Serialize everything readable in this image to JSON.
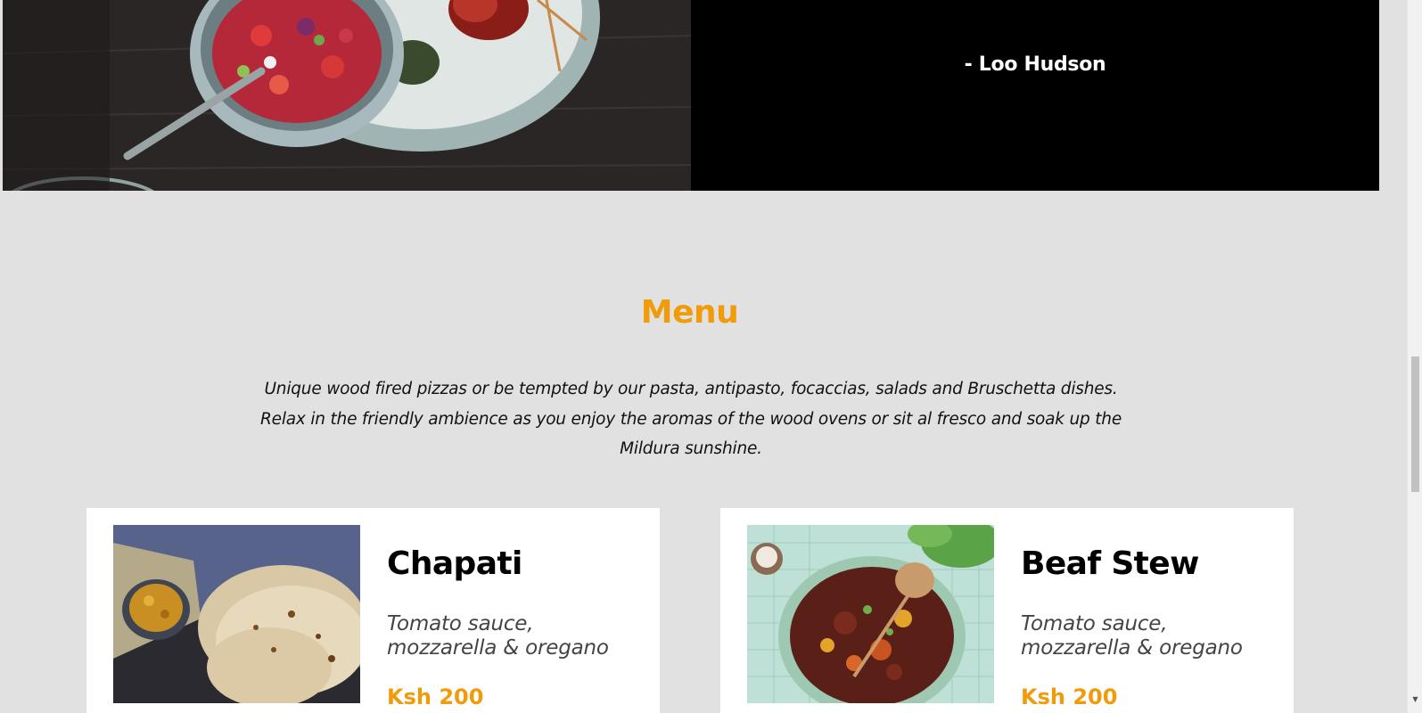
{
  "testimonial": {
    "author": "- Loo Hudson"
  },
  "menu": {
    "title": "Menu",
    "intro": "Unique wood fired pizzas or be tempted by our pasta, antipasto, focaccias, salads and Bruschetta dishes. Relax in the friendly ambience as you enjoy the aromas of the wood ovens or sit al fresco and soak up the Mildura sunshine.",
    "items": [
      {
        "name": "Chapati",
        "description": "Tomato sauce, mozzarella & oregano",
        "price": "Ksh 200"
      },
      {
        "name": "Beaf Stew",
        "description": "Tomato sauce, mozzarella & oregano",
        "price": "Ksh 200"
      }
    ]
  },
  "colors": {
    "accent": "#f09c0a",
    "section_bg": "#e1e1e1",
    "testimonial_bg": "#000000"
  }
}
